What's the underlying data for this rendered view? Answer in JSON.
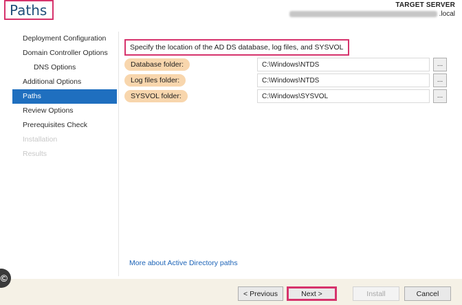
{
  "header": {
    "title": "Paths",
    "target_label": "TARGET SERVER",
    "server_suffix": ".local"
  },
  "sidebar": {
    "items": [
      {
        "label": "Deployment Configuration",
        "state": "normal"
      },
      {
        "label": "Domain Controller Options",
        "state": "normal"
      },
      {
        "label": "DNS Options",
        "state": "normal",
        "sub": true
      },
      {
        "label": "Additional Options",
        "state": "normal"
      },
      {
        "label": "Paths",
        "state": "active"
      },
      {
        "label": "Review Options",
        "state": "normal"
      },
      {
        "label": "Prerequisites Check",
        "state": "normal"
      },
      {
        "label": "Installation",
        "state": "disabled"
      },
      {
        "label": "Results",
        "state": "disabled"
      }
    ]
  },
  "main": {
    "instruction": "Specify the location of the AD DS database, log files, and SYSVOL",
    "fields": [
      {
        "label": "Database folder:",
        "value": "C:\\Windows\\NTDS",
        "browse": "..."
      },
      {
        "label": "Log files folder:",
        "value": "C:\\Windows\\NTDS",
        "browse": "..."
      },
      {
        "label": "SYSVOL folder:",
        "value": "C:\\Windows\\SYSVOL",
        "browse": "..."
      }
    ],
    "help_link": "More about Active Directory paths"
  },
  "footer": {
    "previous": "< Previous",
    "next": "Next >",
    "install": "Install",
    "cancel": "Cancel"
  },
  "colors": {
    "highlight_border": "#d6336c",
    "active_nav": "#1f6fbf",
    "label_highlight": "#f8d6ad",
    "link": "#1c63b7",
    "title": "#1f4e79"
  },
  "icons": {
    "edge_icon": "copyright-icon"
  }
}
